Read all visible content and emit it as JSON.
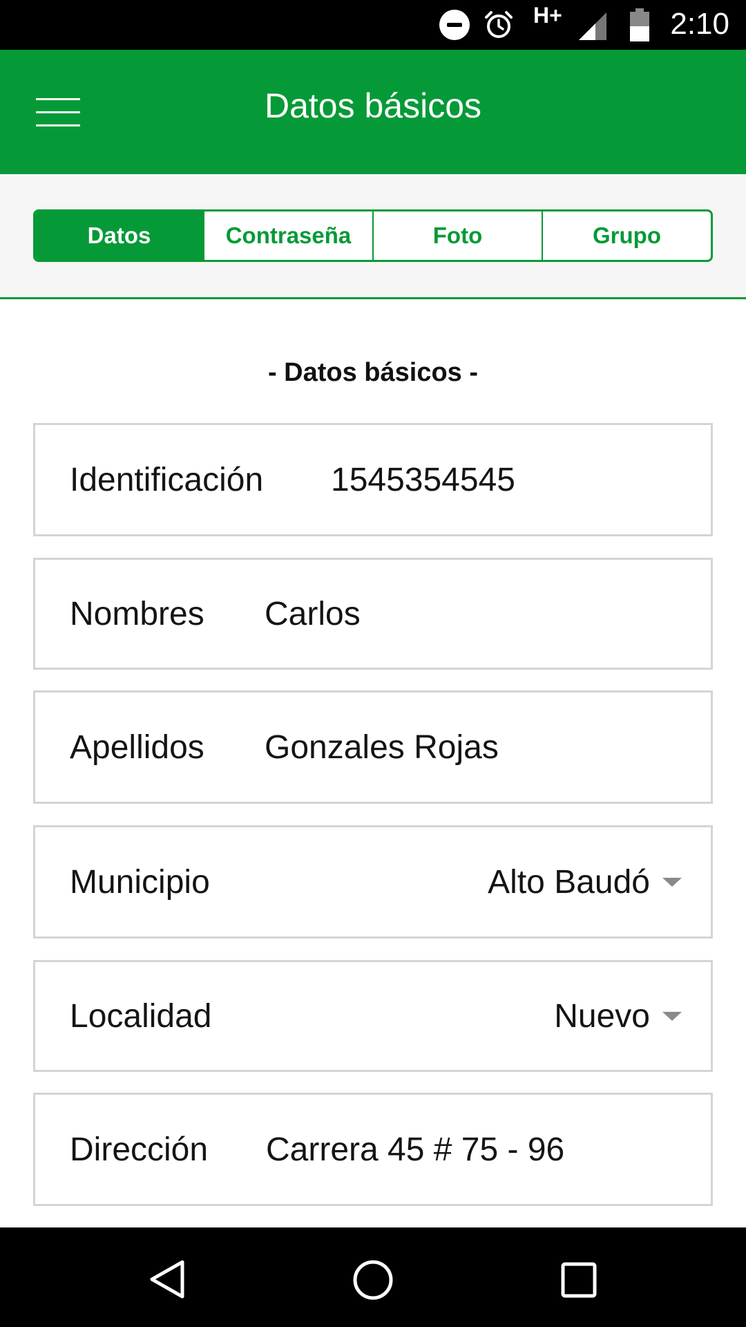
{
  "status_bar": {
    "time": "2:10",
    "network": "H+",
    "icons": [
      "do-not-disturb-icon",
      "alarm-icon",
      "network-type-icon",
      "signal-icon",
      "battery-icon"
    ]
  },
  "app_bar": {
    "title": "Datos básicos",
    "color": "#059a37",
    "menu_icon": "hamburger-menu-icon"
  },
  "tabs": [
    {
      "label": "Datos",
      "active": true
    },
    {
      "label": "Contraseña",
      "active": false
    },
    {
      "label": "Foto",
      "active": false
    },
    {
      "label": "Grupo",
      "active": false
    }
  ],
  "section": {
    "title": "- Datos básicos -"
  },
  "form": {
    "identificacion": {
      "label": "Identificación",
      "value": "1545354545"
    },
    "nombres": {
      "label": "Nombres",
      "value": "Carlos"
    },
    "apellidos": {
      "label": "Apellidos",
      "value": "Gonzales Rojas"
    },
    "municipio": {
      "label": "Municipio",
      "value": "Alto Baudó"
    },
    "localidad": {
      "label": "Localidad",
      "value": "Nuevo"
    },
    "direccion": {
      "label": "Dirección",
      "value": "Carrera 45 # 75 - 96"
    }
  },
  "nav_bar": {
    "icons": [
      "back-icon",
      "home-icon",
      "recents-icon"
    ]
  }
}
